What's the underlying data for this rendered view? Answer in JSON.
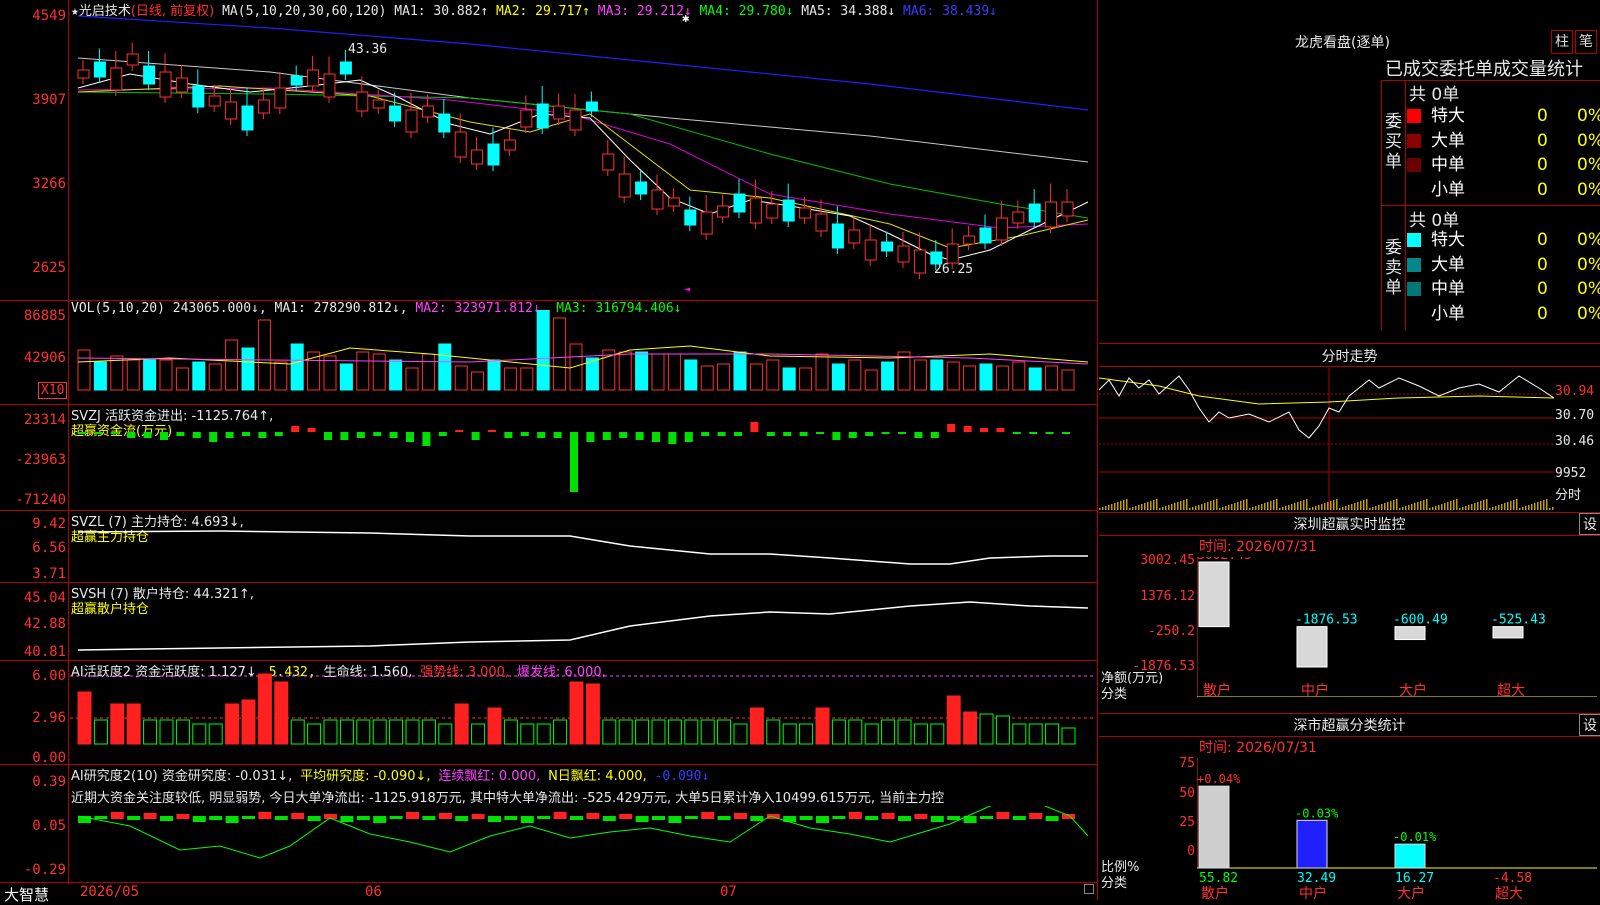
{
  "stock": {
    "title_prefix": "★",
    "name": "光启技术",
    "mode": "(日线, 前复权)",
    "ma_label": "MA(5,10,20,30,60,120)",
    "ma1": "MA1: 30.882↑",
    "ma2": "MA2: 29.717↑",
    "ma3": "MA3: 29.212↓",
    "ma4": "MA4: 29.780↓",
    "ma5": "MA5: 34.388↓",
    "ma6": "MA6: 38.439↓"
  },
  "price_axis": [
    "4549",
    "3907",
    "3266",
    "2625"
  ],
  "price_marks": {
    "high": "43.36",
    "low": "26.25"
  },
  "volume": {
    "header": "VOL(5,10,20)",
    "value": "243065.000↓,",
    "ma1": "MA1: 278290.812↓,",
    "ma2": "MA2: 323971.812↓,",
    "ma3": "MA3: 316794.406↓",
    "axis": [
      "86885",
      "42906"
    ],
    "unit": "X10"
  },
  "svzj": {
    "header": "SVZJ  活跃资金进出: -1125.764↑,",
    "sub": "超赢资金流(万元)",
    "axis": [
      "23314",
      "-23963",
      "-71240"
    ]
  },
  "svzl": {
    "header": "SVZL (7) 主力持仓: 4.693↓,",
    "sub": "超赢主力持仓",
    "axis": [
      "9.42",
      "6.56",
      "3.71"
    ]
  },
  "svsh": {
    "header": "SVSH (7) 散户持仓: 44.321↑,",
    "sub": "超赢散户持仓",
    "axis": [
      "45.04",
      "42.88",
      "40.81"
    ]
  },
  "ai1": {
    "h1": "AI活跃度2 资金活跃度: 1.127↓,",
    "h2": "5.432,",
    "h3": "生命线: 1.560,",
    "h4": "强势线: 3.000,",
    "h5": "爆发线: 6.000,",
    "axis": [
      "6.00",
      "2.96",
      "0.00"
    ]
  },
  "ai2": {
    "h1": "AI研究度2(10) 资金研究度: -0.031↓,",
    "h2": "平均研究度: -0.090↓,",
    "h3": "连续飘红: 0.000,",
    "h4": "N日飘红: 4.000,",
    "h5": "-0.090↓",
    "text": "近期大资金关注度较低, 明显弱势, 今日大单净流出: -1125.918万元, 其中特大单净流出: -525.429万元, 大单5日累计净入10499.615万元, 当前主力控",
    "axis": [
      "0.39",
      "0.05",
      "-0.29"
    ]
  },
  "timeline": {
    "brand": "大智慧",
    "labels": [
      "2026/05",
      "06",
      "07"
    ]
  },
  "dragon": {
    "title": "龙虎看盘(逐单)",
    "btn1": "柱",
    "btn2": "笔",
    "subtitle": "已成交委托单成交量统计",
    "buy_label": "委买单",
    "sell_label": "委卖单",
    "buy_total": "共 0单",
    "sell_total": "共 0单",
    "buy_rows": [
      {
        "name": "特大",
        "val": "0",
        "pct": "0%",
        "color": "#ff0000"
      },
      {
        "name": "大单",
        "val": "0",
        "pct": "0%",
        "color": "#8b0000"
      },
      {
        "name": "中单",
        "val": "0",
        "pct": "0%",
        "color": "#6b0000"
      },
      {
        "name": "小单",
        "val": "0",
        "pct": "0%",
        "color": "#000000"
      }
    ],
    "sell_rows": [
      {
        "name": "特大",
        "val": "0",
        "pct": "0%",
        "color": "#00ffff"
      },
      {
        "name": "大单",
        "val": "0",
        "pct": "0%",
        "color": "#008888"
      },
      {
        "name": "中单",
        "val": "0",
        "pct": "0%",
        "color": "#007777"
      },
      {
        "name": "小单",
        "val": "0",
        "pct": "0%",
        "color": "#000000"
      }
    ]
  },
  "intraday": {
    "title": "分时走势",
    "prices": [
      "30.94",
      "30.70",
      "30.46"
    ],
    "vol": "9952",
    "label": "分时"
  },
  "monitor": {
    "title": "深圳超赢实时监控",
    "btn": "设",
    "time": "时间: 2026/07/31",
    "axis": [
      "3002.45",
      "1376.12",
      "-250.2",
      "-1876.53"
    ],
    "ylabel1": "净额(万元)",
    "ylabel2": "分类",
    "cats": [
      "散户",
      "中户",
      "大户",
      "超大"
    ],
    "values": [
      "3002.45",
      "-1876.53",
      "-600.49",
      "-525.43"
    ]
  },
  "classify": {
    "title": "深市超赢分类统计",
    "btn": "设",
    "time": "时间: 2026/07/31",
    "axis": [
      "75",
      "50",
      "25",
      "0"
    ],
    "ylabel1": "比例%",
    "ylabel2": "分类",
    "cats": [
      "散户",
      "中户",
      "大户",
      "超大"
    ],
    "changes": [
      "+0.04%",
      "-0.03%",
      "-0.01%",
      ""
    ],
    "values": [
      "55.82",
      "32.49",
      "16.27",
      "-4.58"
    ]
  }
}
